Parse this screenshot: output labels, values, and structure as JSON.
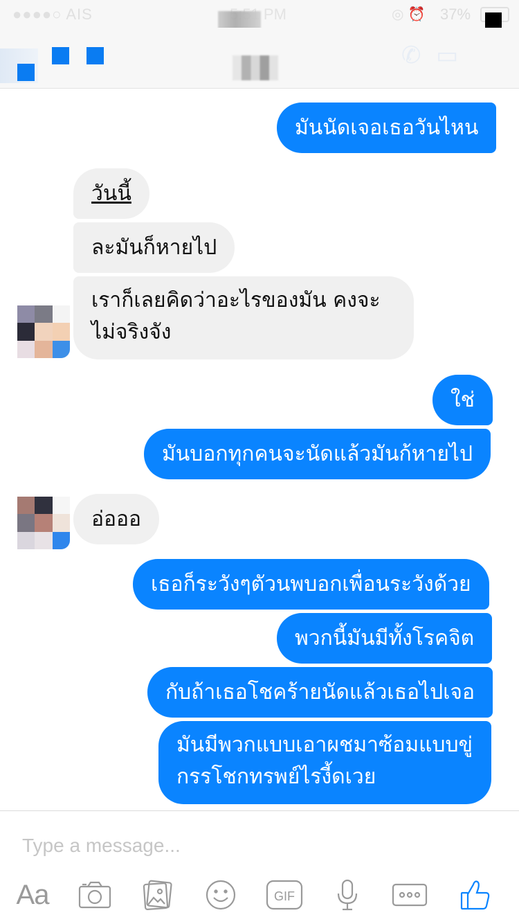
{
  "status_bar": {
    "carrier": "●●●●○ AIS",
    "time": "5:51 PM",
    "battery": "37%"
  },
  "messages": [
    {
      "text": "มันนัดเจอเธอวันไหน",
      "sender": "me"
    },
    {
      "text": "วันนี้",
      "sender": "them"
    },
    {
      "text": "ละมันก็หายไป",
      "sender": "them"
    },
    {
      "text": "เราก็เลยคิดว่าอะไรของมัน คงจะไม่จริงจัง",
      "sender": "them"
    },
    {
      "text": "ใช่",
      "sender": "me"
    },
    {
      "text": "มันบอกทุกคนจะนัดแล้วมันก้หายไป",
      "sender": "me"
    },
    {
      "text": "อ่อออ",
      "sender": "them"
    },
    {
      "text": "เธอก็ระวังๆตัวนพบอกเพื่อนระวังด้วย",
      "sender": "me"
    },
    {
      "text": "พวกนี้มันมีทั้งโรคจิต",
      "sender": "me"
    },
    {
      "text": "กับถ้าเธอโชคร้ายนัดแล้วเธอไปเจอ",
      "sender": "me"
    },
    {
      "text": "มันมีพวกแบบเอาผชมาซ้อมแบบขู่กรรโชกทรพย์ไรงี้ดเวย",
      "sender": "me"
    }
  ],
  "composer": {
    "placeholder": "Type a message...",
    "aa_label": "Aa",
    "gif_label": "GIF"
  },
  "colors": {
    "outgoing_bubble": "#0a84ff",
    "incoming_bubble": "#f0f0f0",
    "like_icon": "#0a84ff"
  },
  "icons": [
    "camera-icon",
    "photo-icon",
    "emoji-icon",
    "gif-icon",
    "microphone-icon",
    "more-icon",
    "like-icon"
  ]
}
